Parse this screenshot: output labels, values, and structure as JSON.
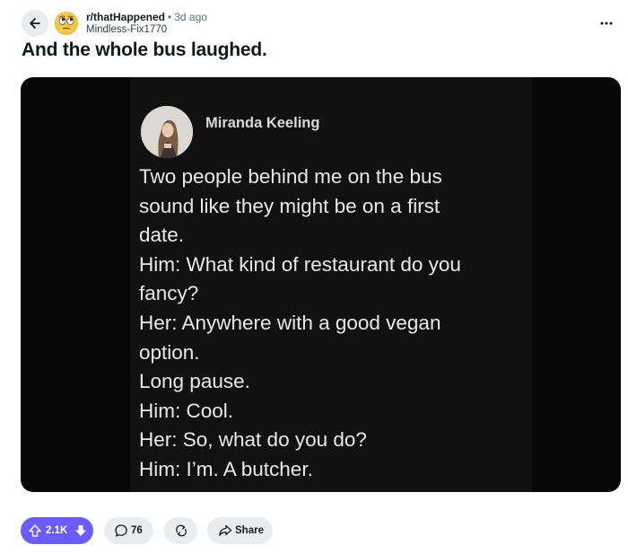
{
  "post": {
    "subreddit": "r/thatHappened",
    "age": "3d ago",
    "author": "Mindless-Fix1770",
    "title": "And the whole bus laughed."
  },
  "media": {
    "tweet_author": "Miranda Keeling",
    "tweet_lines": [
      "Two people behind me on the bus",
      "sound like they might be on a first",
      "date.",
      "Him: What kind of restaurant do you",
      "fancy?",
      "Her: Anywhere with a good vegan",
      "option.",
      "Long pause.",
      "Him: Cool.",
      "Her: So, what do you do?",
      "Him: I’m. A butcher."
    ]
  },
  "actions": {
    "score": "2.1K",
    "comments": "76",
    "share_label": "Share"
  },
  "icons": {
    "back": "arrow-left-icon",
    "subreddit": "rolling-eyes-emoji-icon",
    "more": "ellipsis-icon",
    "upvote": "arrow-up-icon",
    "downvote": "arrow-down-icon",
    "comment": "speech-bubble-icon",
    "crosspost": "refresh-arrows-icon",
    "share": "share-arrow-icon"
  },
  "colors": {
    "vote_accent": "#6a5cff",
    "pill_bg": "#eaedef",
    "media_bg": "#070707"
  }
}
